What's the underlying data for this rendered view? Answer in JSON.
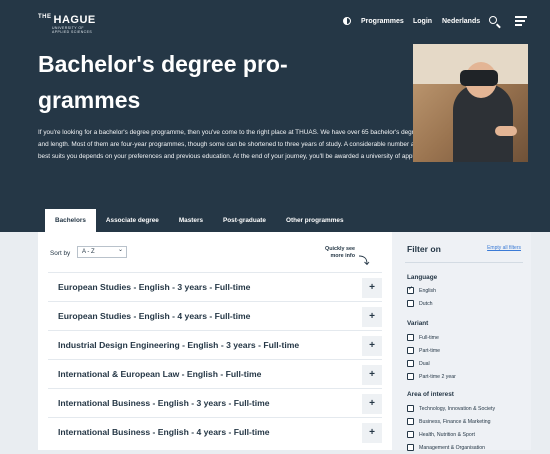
{
  "header": {
    "logo": {
      "the": "THE",
      "name": "HAGUE",
      "sub": [
        "UNIVERSITY OF",
        "APPLIED SCIENCES"
      ]
    },
    "nav": [
      {
        "label": "Programmes"
      },
      {
        "label": "Login"
      },
      {
        "label": "Nederlands"
      }
    ]
  },
  "hero": {
    "title": "Bachelor's degree pro-grammes",
    "intro": "If you're looking for a bachelor's degree programme, then you've come to the right place at THUAS. We have over 65 bachelor's degree programmes which vary in type and length. Most of them are four-year programmes, though some can be shortened to three years of study. A considerable number are taught in English. The variant that best suits you depends on your preferences and previous education. At the end of your journey, you'll be awarded a university of applied sciences diploma."
  },
  "tabs": [
    "Bachelors",
    "Associate degree",
    "Masters",
    "Post-graduate",
    "Other programmes"
  ],
  "sort": {
    "label": "Sort by",
    "value": "A - Z"
  },
  "quick_see": "Quickly see more info",
  "programmes": [
    "European Studies - English - 3 years - Full-time",
    "European Studies - English - 4 years - Full-time",
    "Industrial Design Engineering - English - 3 years - Full-time",
    "International & European Law - English - Full-time",
    "International Business - English - 3 years - Full-time",
    "International Business - English - 4 years - Full-time"
  ],
  "expand_symbol": "+",
  "filter": {
    "title": "Filter on",
    "empty_all": "Empty all filters",
    "groups": [
      {
        "title": "Language",
        "options": [
          {
            "label": "English",
            "checked": true
          },
          {
            "label": "Dutch",
            "checked": false
          }
        ]
      },
      {
        "title": "Variant",
        "options": [
          {
            "label": "Full-time",
            "checked": false
          },
          {
            "label": "Part-time",
            "checked": false
          },
          {
            "label": "Dual",
            "checked": false
          },
          {
            "label": "Part-time 2 year",
            "checked": false
          }
        ]
      },
      {
        "title": "Area of interest",
        "options": [
          {
            "label": "Technology, Innovation & Society",
            "checked": false
          },
          {
            "label": "Business, Finance & Marketing",
            "checked": false
          },
          {
            "label": "Health, Nutrition & Sport",
            "checked": false
          },
          {
            "label": "Management & Organisation",
            "checked": false
          }
        ]
      }
    ]
  },
  "colors": {
    "navy": "#253746",
    "link": "#3b7bd6",
    "panel": "#eef1f5"
  }
}
